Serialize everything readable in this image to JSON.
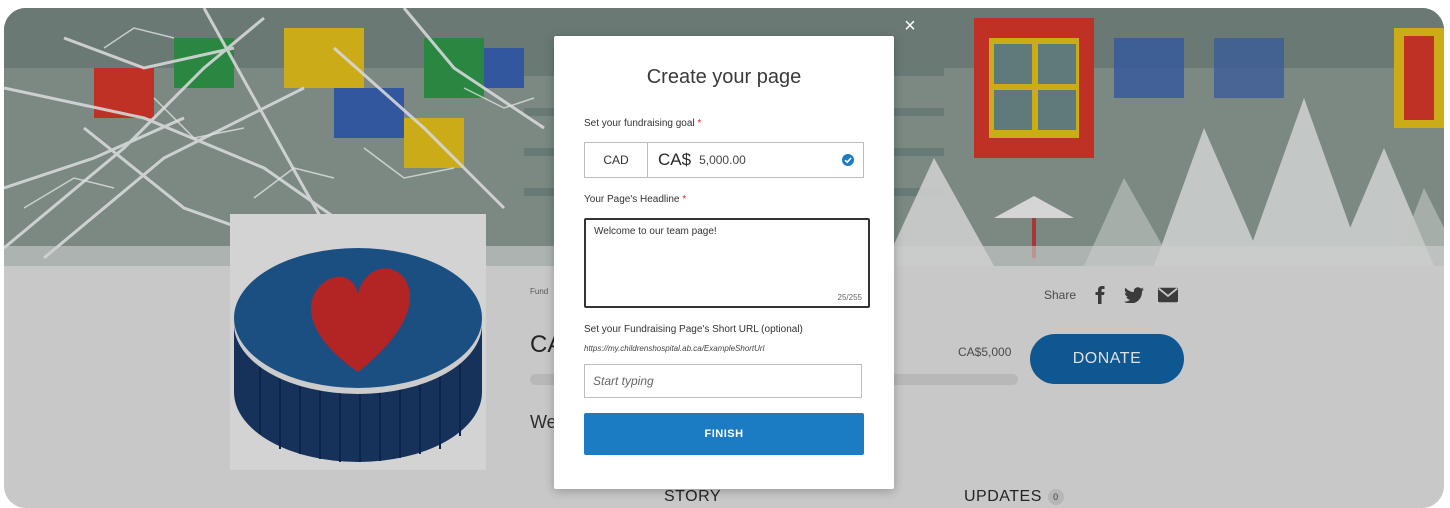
{
  "page": {
    "fundraiser_label": "Fund",
    "title_peek": "CA",
    "welcome_peek": "We",
    "goal_amount": "CA$5,000",
    "donate_label": "DONATE",
    "share_label": "Share",
    "tabs": [
      {
        "label": "STORY"
      },
      {
        "label": "UPDATES",
        "count": "0"
      }
    ],
    "icons": [
      "facebook-icon",
      "twitter-icon",
      "email-icon",
      "close-icon",
      "check-icon"
    ]
  },
  "modal": {
    "title": "Create your page",
    "goal_label": "Set your fundraising goal",
    "required_mark": "*",
    "currency_code": "CAD",
    "currency_symbol": "CA$",
    "goal_value": "5,000.00",
    "headline_label": "Your Page's Headline",
    "headline_value": "Welcome to our team page!",
    "headline_counter": "25/255",
    "short_url_label": "Set your Fundraising Page's Short URL (optional)",
    "short_url_example": "https://my.childrenshospital.ab.ca/ExampleShortUrl",
    "short_url_placeholder": "Start typing",
    "finish_label": "FINISH",
    "close_symbol": "×"
  },
  "colors": {
    "brand_blue": "#1064a6",
    "button_blue": "#1b7cc3",
    "heart_red": "#cc2a2a",
    "required_red": "#d9272e"
  }
}
